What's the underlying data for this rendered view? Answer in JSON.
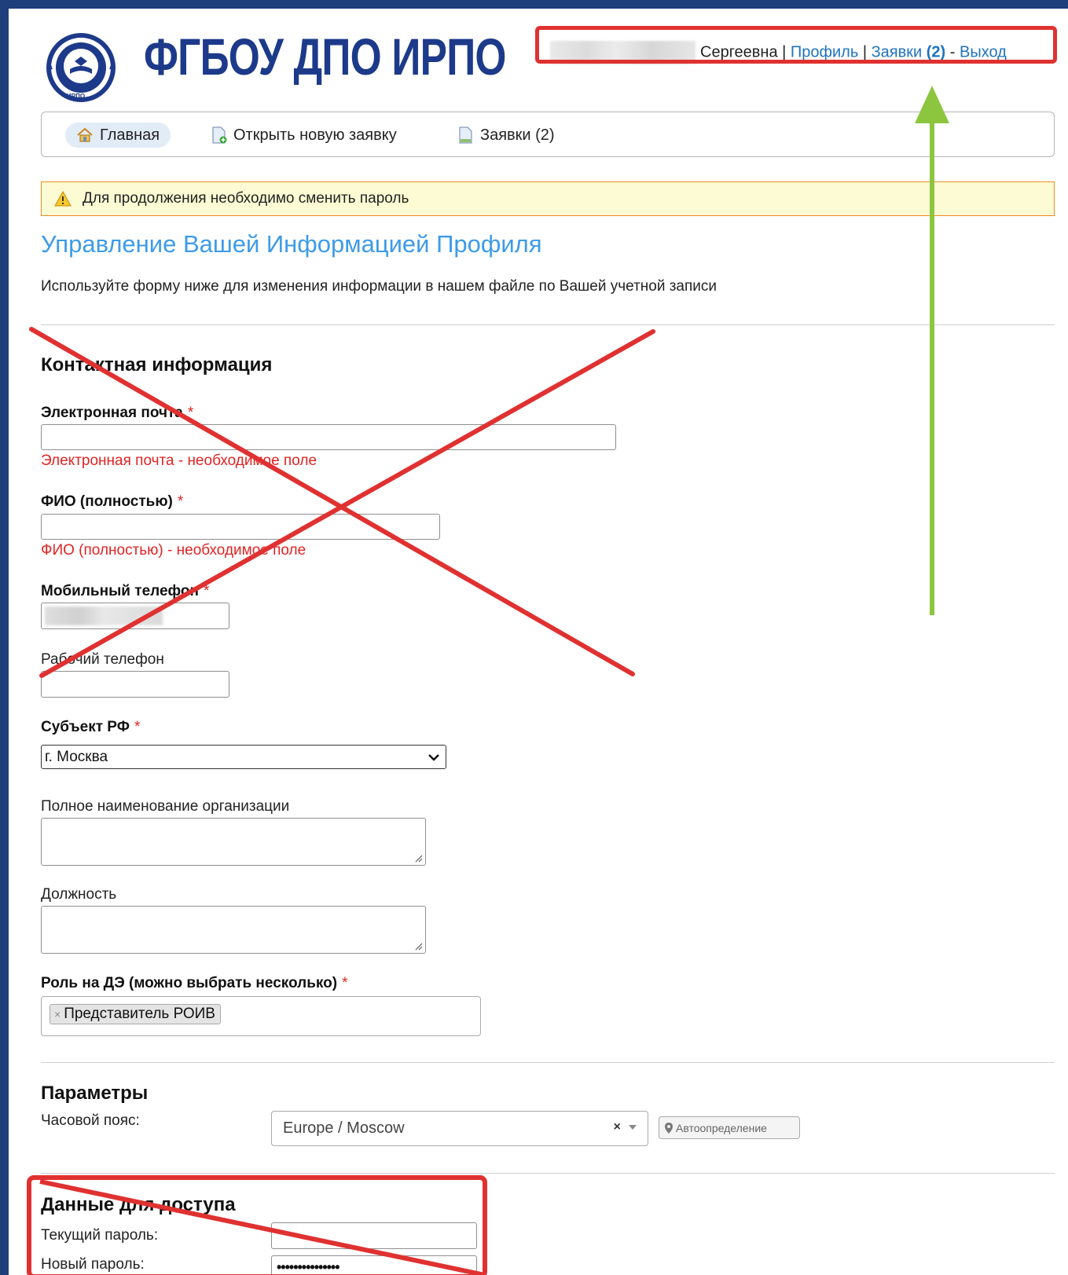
{
  "header": {
    "org_name": "ФГБОУ ДПО ИРПО",
    "logo_caption": "ИРПО",
    "user_surname": "Сергеевна",
    "sep1": "|",
    "profile_link": "Профиль",
    "sep2": "|",
    "tickets_link": "Заявки",
    "tickets_count": "(2)",
    "sep3": "-",
    "logout_link": "Выход"
  },
  "nav": {
    "home": "Главная",
    "new_ticket": "Открыть новую заявку",
    "tickets": "Заявки (2)"
  },
  "notice": "Для продолжения необходимо сменить пароль",
  "page": {
    "title": "Управление Вашей Информацией Профиля",
    "description": "Используйте форму ниже для изменения информации в нашем файле по Вашей учетной записи"
  },
  "contact": {
    "title": "Контактная информация",
    "email_label": "Электронная почта",
    "email_value": "",
    "email_error": "Электронная почта - необходимое поле",
    "fio_label": "ФИО (полностью)",
    "fio_value": "",
    "fio_error": "ФИО (полностью) - необходимое поле",
    "mobile_label": "Мобильный телефон",
    "work_phone_label": "Рабочий телефон",
    "work_phone_value": "",
    "region_label": "Субъект РФ",
    "region_value": "г. Москва",
    "org_label": "Полное наименование организации",
    "position_label": "Должность",
    "role_label": "Роль на ДЭ (можно выбрать несколько)",
    "role_tag": "Представитель РОИВ",
    "role_tag_remove": "×",
    "required_mark": "*"
  },
  "params": {
    "title": "Параметры",
    "tz_label": "Часовой пояс:",
    "tz_value": "Europe / Moscow",
    "tz_clear": "×",
    "auto_detect": "Автоопределение"
  },
  "access": {
    "title": "Данные для доступа",
    "current_pw_label": "Текущий пароль:",
    "new_pw_label": "Новый пароль:",
    "new_pw_value": "•••••••••••••••"
  },
  "colors": {
    "brand_blue": "#1d3a8a",
    "link_blue": "#1e73be",
    "heading_blue": "#3d9be9",
    "error_red": "#e02424",
    "annotation_red": "#e03131",
    "annotation_green": "#8cc63f",
    "notice_bg": "#fdfbd3",
    "notice_border": "#f08a24"
  }
}
